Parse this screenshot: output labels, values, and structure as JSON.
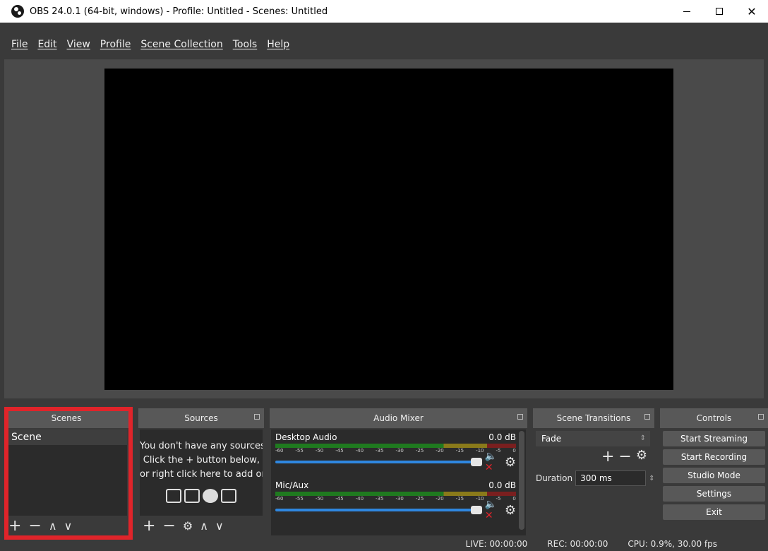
{
  "window": {
    "title": "OBS 24.0.1 (64-bit, windows) - Profile: Untitled - Scenes: Untitled"
  },
  "menu": [
    {
      "label": "File"
    },
    {
      "label": "Edit"
    },
    {
      "label": "View"
    },
    {
      "label": "Profile"
    },
    {
      "label": "Scene Collection"
    },
    {
      "label": "Tools"
    },
    {
      "label": "Help"
    }
  ],
  "docks": {
    "scenes": {
      "title": "Scenes",
      "items": [
        "Scene"
      ]
    },
    "sources": {
      "title": "Sources",
      "empty_text": [
        "You don't have any sources",
        "Click the + button below,",
        "or right click here to add one"
      ]
    },
    "mixer": {
      "title": "Audio Mixer",
      "channels": [
        {
          "name": "Desktop Audio",
          "db": "0.0 dB"
        },
        {
          "name": "Mic/Aux",
          "db": "0.0 dB"
        }
      ],
      "ticks": [
        "-60",
        "-55",
        "-50",
        "-45",
        "-40",
        "-35",
        "-30",
        "-25",
        "-20",
        "-15",
        "-10",
        "-5",
        "0"
      ]
    },
    "transitions": {
      "title": "Scene Transitions",
      "selected": "Fade",
      "duration_label": "Duration",
      "duration_value": "300 ms"
    },
    "controls": {
      "title": "Controls",
      "buttons": [
        "Start Streaming",
        "Start Recording",
        "Studio Mode",
        "Settings",
        "Exit"
      ]
    }
  },
  "status": {
    "live": "LIVE: 00:00:00",
    "rec": "REC: 00:00:00",
    "cpu": "CPU: 0.9%, 30.00 fps"
  },
  "colors": {
    "highlight": "#e0242a",
    "fader": "#2f87e0"
  }
}
